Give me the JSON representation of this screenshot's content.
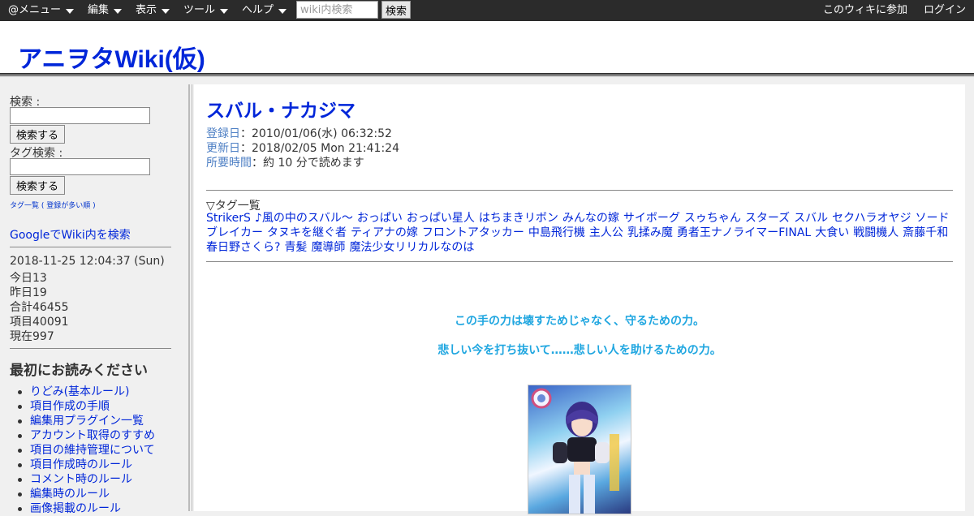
{
  "topbar": {
    "menus": [
      "@メニュー",
      "編集",
      "表示",
      "ツール",
      "ヘルプ"
    ],
    "search_placeholder": "wiki内検索",
    "search_button": "検索",
    "join_link": "このウィキに参加",
    "login_link": "ログイン"
  },
  "site": {
    "title": "アニヲタWiki(仮)"
  },
  "sidebar": {
    "search_label": "検索 :",
    "search_button": "検索する",
    "tag_search_label": "タグ検索 :",
    "tag_search_button": "検索する",
    "tag_list_link": "タグ一覧 ( 登録が多い順 )",
    "google_link": "GoogleでWiki内を検索",
    "stats": {
      "datetime": "2018-11-25 12:04:37 (Sun)",
      "today": "今日13",
      "yesterday": "昨日19",
      "total": "合計46455",
      "items": "項目40091",
      "current": "現在997"
    },
    "read_first_heading": "最初にお読みください",
    "read_first_items": [
      "りどみ(基本ルール)",
      "項目作成の手順",
      "編集用プラグイン一覧",
      "アカウント取得のすすめ",
      "項目の維持管理について",
      "項目作成時のルール",
      "コメント時のルール",
      "編集時のルール",
      "画像掲載のルール"
    ]
  },
  "main": {
    "title": "スバル・ナカジマ",
    "registered_label": "登録日",
    "registered_value": "：2010/01/06(水) 06:32:52",
    "updated_label": "更新日",
    "updated_value": "：2018/02/05 Mon 21:41:24",
    "readtime_label": "所要時間",
    "readtime_value": "：約 10 分で読めます",
    "tags_title": "▽タグ一覧",
    "tags": [
      "StrikerS",
      "♪風の中のスバル〜",
      "おっぱい",
      "おっぱい星人",
      "はちまきリボン",
      "みんなの嫁",
      "サイボーグ",
      "スゥちゃん",
      "スターズ",
      "スバル",
      "セクハラオヤジ",
      "ソードブレイカー",
      "タヌキを継ぐ者",
      "ティアナの嫁",
      "フロントアタッカー",
      "中島飛行機",
      "主人公",
      "乳揉み魔",
      "勇者王ナノライマーFINAL",
      "大食い",
      "戦闘機人",
      "斎藤千和",
      "春日野さくら?",
      "青髪",
      "魔導師",
      "魔法少女リリカルなのは"
    ],
    "quote1": "この手の力は壊すためじゃなく、守るための力。",
    "quote2": "悲しい今を打ち抜いて……悲しい人を助けるための力。",
    "image_name": "character-card-image"
  }
}
